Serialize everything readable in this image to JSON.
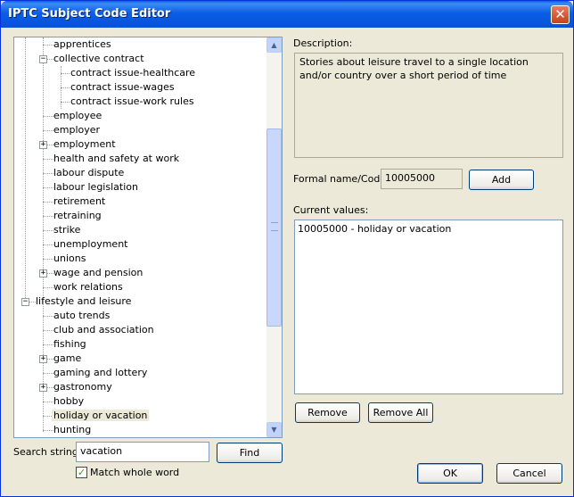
{
  "window": {
    "title": "IPTC Subject Code Editor"
  },
  "tree": {
    "items": [
      {
        "label": "apprentices"
      },
      {
        "label": "collective contract"
      },
      {
        "label": "contract issue-healthcare"
      },
      {
        "label": "contract issue-wages"
      },
      {
        "label": "contract issue-work rules"
      },
      {
        "label": "employee"
      },
      {
        "label": "employer"
      },
      {
        "label": "employment"
      },
      {
        "label": "health and safety at work"
      },
      {
        "label": "labour dispute"
      },
      {
        "label": "labour legislation"
      },
      {
        "label": "retirement"
      },
      {
        "label": "retraining"
      },
      {
        "label": "strike"
      },
      {
        "label": "unemployment"
      },
      {
        "label": "unions"
      },
      {
        "label": "wage and pension"
      },
      {
        "label": "work relations"
      },
      {
        "label": "lifestyle and leisure"
      },
      {
        "label": "auto trends"
      },
      {
        "label": "club and association"
      },
      {
        "label": "fishing"
      },
      {
        "label": "game"
      },
      {
        "label": "gaming and lottery"
      },
      {
        "label": "gastronomy"
      },
      {
        "label": "hobby"
      },
      {
        "label": "holiday or vacation"
      },
      {
        "label": "hunting"
      }
    ],
    "selected": "holiday or vacation"
  },
  "search": {
    "label": "Search string:",
    "value": "vacation",
    "find_label": "Find",
    "match_label": "Match whole word",
    "match_checked": true
  },
  "description": {
    "label": "Description:",
    "text": "Stories about leisure travel to a single location and/or country over a short period of time"
  },
  "formal": {
    "label": "Formal name/Code:",
    "value": "10005000",
    "add_label": "Add"
  },
  "current": {
    "label": "Current values:",
    "items": [
      "10005000 - holiday or vacation"
    ]
  },
  "buttons": {
    "remove": "Remove",
    "remove_all": "Remove All",
    "ok": "OK",
    "cancel": "Cancel"
  }
}
